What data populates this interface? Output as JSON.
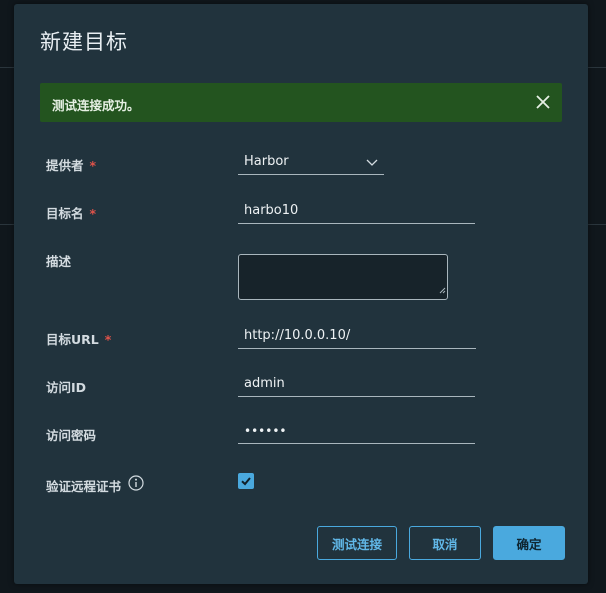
{
  "dialog": {
    "title": "新建目标"
  },
  "alert": {
    "message": "测试连接成功。",
    "close_icon": "close-icon",
    "color": "#23541f"
  },
  "form": {
    "provider": {
      "label": "提供者",
      "required": "*",
      "value": "Harbor"
    },
    "target_name": {
      "label": "目标名",
      "required": "*",
      "value": "harbo10"
    },
    "description": {
      "label": "描述",
      "value": ""
    },
    "target_url": {
      "label": "目标URL",
      "required": "*",
      "value": "http://10.0.0.10/"
    },
    "access_id": {
      "label": "访问ID",
      "value": "admin"
    },
    "access_secret": {
      "label": "访问密码",
      "value": "••••••"
    },
    "verify_cert": {
      "label": "验证远程证书",
      "checked": true,
      "info_icon": "info-icon"
    }
  },
  "buttons": {
    "test": "测试连接",
    "cancel": "取消",
    "ok": "确定"
  },
  "colors": {
    "accent": "#4aa9de",
    "required": "#e0534a",
    "dialog_bg": "#21333d"
  }
}
